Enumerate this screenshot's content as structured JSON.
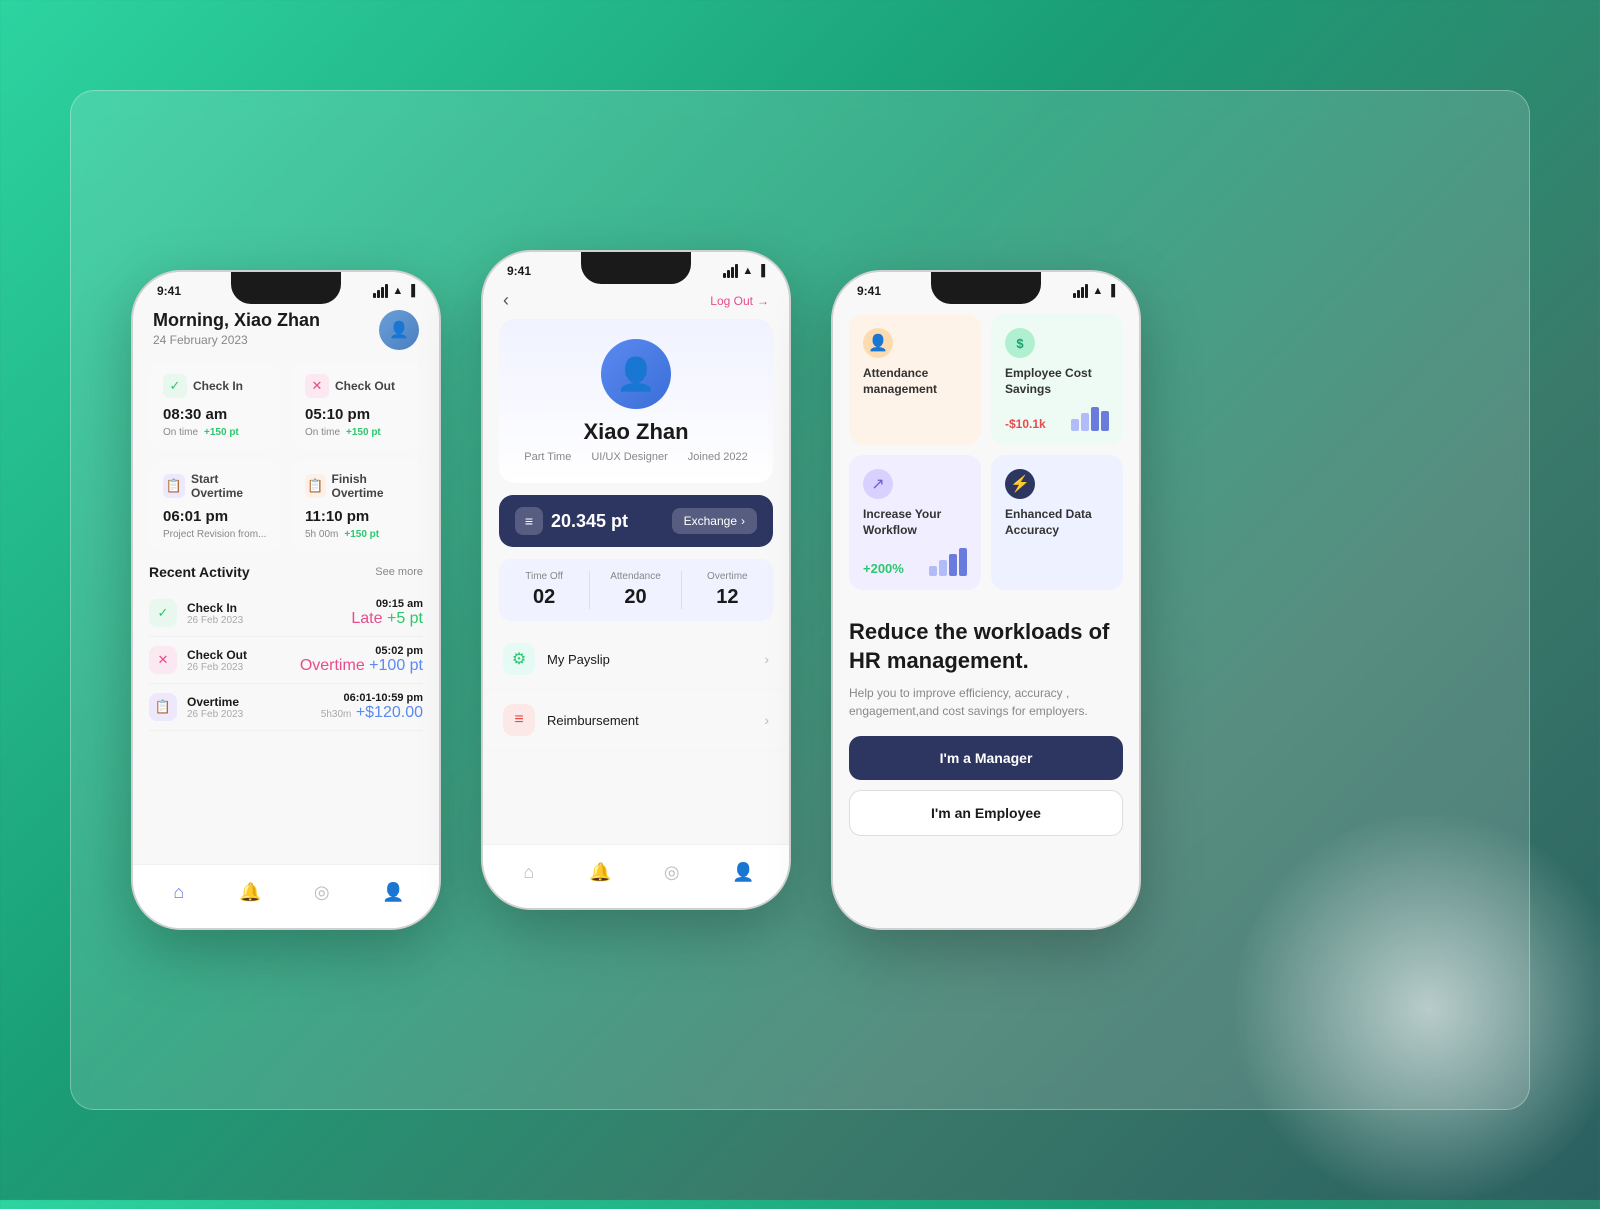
{
  "background": {
    "gradient_start": "#2dd4a0",
    "gradient_end": "#2a6060"
  },
  "phone1": {
    "status_time": "9:41",
    "greeting": "Morning, Xiao Zhan",
    "date": "24 February 2023",
    "cards": [
      {
        "icon": "✓",
        "icon_class": "icon-green",
        "title": "Check In",
        "time": "08:30 am",
        "status": "On time",
        "points": "+150 pt",
        "points_class": "card-status-points"
      },
      {
        "icon": "✗",
        "icon_class": "icon-pink",
        "title": "Check Out",
        "time": "05:10 pm",
        "status": "On time",
        "points": "+150 pt",
        "points_class": "card-status-points"
      },
      {
        "icon": "📋",
        "icon_class": "icon-purple",
        "title": "Start Overtime",
        "time": "06:01 pm",
        "status": "Project Revision from...",
        "points": "",
        "points_class": ""
      },
      {
        "icon": "📋",
        "icon_class": "icon-orange",
        "title": "Finish Overtime",
        "time": "11:10 pm",
        "status": "5h 00m",
        "points": "+150 pt",
        "points_class": "card-status-points"
      }
    ],
    "recent_activity_title": "Recent Activity",
    "see_more": "See more",
    "activities": [
      {
        "icon": "✓",
        "icon_class": "icon-green",
        "name": "Check In",
        "date": "26 Feb 2023",
        "time": "09:15 am",
        "status": "Late",
        "points": "+5 pt",
        "status_class": "status-late",
        "points_class": "status-points-green"
      },
      {
        "icon": "✗",
        "icon_class": "icon-pink",
        "name": "Check Out",
        "date": "26 Feb 2023",
        "time": "05:02 pm",
        "status": "Overtime",
        "points": "+100 pt",
        "status_class": "status-overtime",
        "points_class": "status-points-blue"
      },
      {
        "icon": "📋",
        "icon_class": "icon-purple",
        "name": "Overtime",
        "date": "26 Feb 2023",
        "time": "06:01-10:59 pm",
        "status": "5h30m",
        "points": "+$120.00",
        "status_class": "",
        "points_class": "status-points-blue"
      }
    ]
  },
  "phone2": {
    "status_time": "9:41",
    "back_label": "‹",
    "logout_label": "Log Out",
    "profile_name": "Xiao Zhan",
    "profile_type": "Part Time",
    "profile_role": "UI/UX Designer",
    "profile_joined": "Joined 2022",
    "points_value": "20.345 pt",
    "exchange_label": "Exchange",
    "stats": [
      {
        "label": "Time Off",
        "value": "02"
      },
      {
        "label": "Attendance",
        "value": "20"
      },
      {
        "label": "Overtime",
        "value": "12"
      }
    ],
    "menu_items": [
      {
        "icon": "⚙",
        "icon_class": "teal",
        "label": "My Payslip"
      },
      {
        "icon": "≡",
        "icon_class": "red",
        "label": "Reimbursement"
      }
    ]
  },
  "phone3": {
    "status_time": "9:41",
    "feature_cards": [
      {
        "icon": "👤",
        "icon_class": "icon-bg-orange",
        "bg_class": "orange-bg",
        "title": "Attendance management",
        "value": "",
        "has_chart": false
      },
      {
        "icon": "$",
        "icon_class": "icon-bg-green",
        "bg_class": "green-bg",
        "title": "Employee Cost Savings",
        "value": "-$10.1k",
        "has_chart": true
      },
      {
        "icon": "↗",
        "icon_class": "icon-bg-purple",
        "bg_class": "purple-bg",
        "title": "Increase Your Workflow",
        "value": "+200%",
        "has_chart": true
      },
      {
        "icon": "⚡",
        "icon_class": "icon-bg-dark",
        "bg_class": "blue-bg",
        "title": "Enhanced Data Accuracy",
        "value": "",
        "has_chart": false
      }
    ],
    "promo_title": "Reduce the workloads of HR management.",
    "promo_desc": "Help you to improve efficiency, accuracy , engagement,and cost savings for employers.",
    "btn_manager": "I'm a Manager",
    "btn_employee": "I'm an Employee"
  }
}
